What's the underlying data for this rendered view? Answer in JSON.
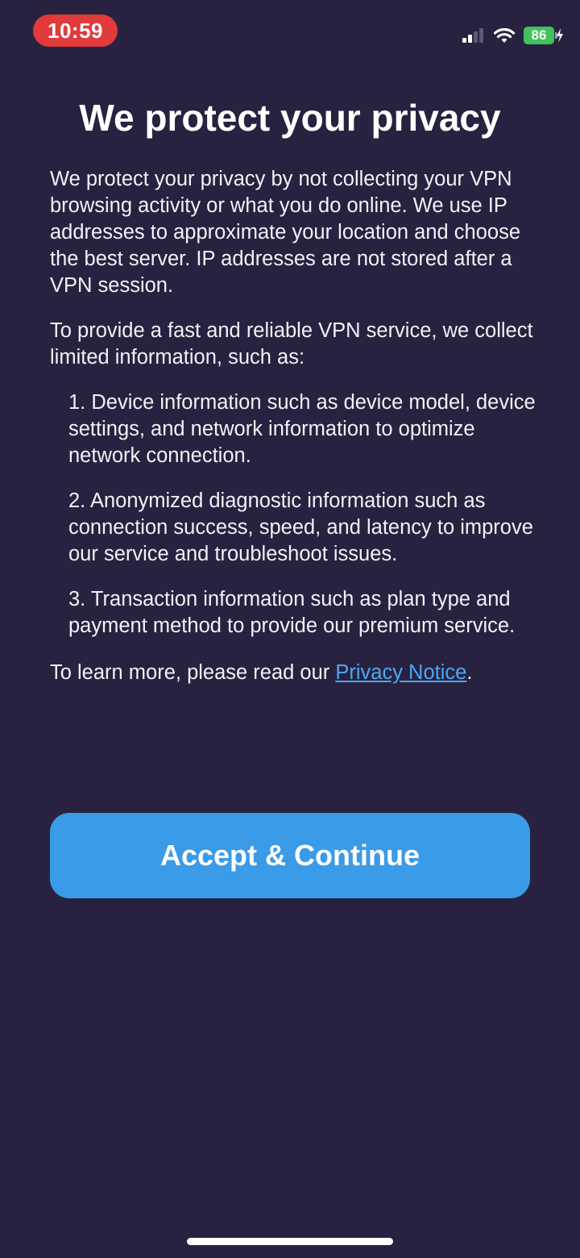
{
  "status_bar": {
    "time": "10:59",
    "battery_level": "86",
    "icons": [
      "cellular-signal-icon",
      "wifi-icon",
      "battery-charging-icon"
    ],
    "time_pill_color": "#e03a3a",
    "battery_color": "#3fc35a"
  },
  "title": "We protect your privacy",
  "intro": "We protect your privacy by not collecting your VPN browsing activity or what you do online. We use IP addresses to approximate your location and choose the best server. IP addresses are not stored after a VPN session.",
  "collect_intro": "To provide a fast and reliable VPN service, we collect limited information, such as:",
  "items": [
    "1. Device information such as device model, device settings, and network information to optimize network connection.",
    "2. Anonymized diagnostic information such as connection success, speed, and latency to improve our service and troubleshoot issues.",
    "3. Transaction information such as plan type and payment method to provide our premium service."
  ],
  "learn_more": {
    "prefix": "To learn more, please read our ",
    "link_text": "Privacy Notice",
    "suffix": "."
  },
  "accept_button": {
    "label": "Accept & Continue"
  },
  "colors": {
    "background": "#282240",
    "accent": "#3a9be8",
    "link": "#4aa8f5"
  }
}
